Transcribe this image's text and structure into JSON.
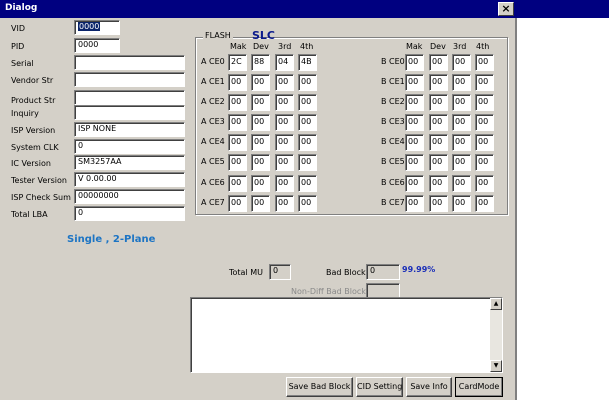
{
  "window": {
    "title": "Dialog",
    "close_glyph": "×"
  },
  "device": {
    "fields": [
      {
        "label": "VID",
        "value": "0000"
      },
      {
        "label": "PID",
        "value": "0000"
      },
      {
        "label": "Serial",
        "value": ""
      },
      {
        "label": "Vendor Str",
        "value": ""
      },
      {
        "label": "Product Str",
        "value": ""
      },
      {
        "label": "Inquiry",
        "value": ""
      },
      {
        "label": "ISP Version",
        "value": "ISP NONE"
      },
      {
        "label": "System CLK",
        "value": "0"
      },
      {
        "label": "IC Version",
        "value": "SM3257AA"
      },
      {
        "label": "Tester Version",
        "value": "V 0.00.00"
      },
      {
        "label": "ISP Check Sum",
        "value": "00000000"
      },
      {
        "label": "Total LBA",
        "value": "0"
      }
    ]
  },
  "flash": {
    "group_title": "FLASH",
    "cell_type": "SLC",
    "columns": [
      "Mak",
      "Dev",
      "3rd",
      "4th"
    ],
    "a_rows": [
      {
        "label": "A CE0",
        "values": [
          "2C",
          "88",
          "04",
          "4B"
        ]
      },
      {
        "label": "A CE1",
        "values": [
          "00",
          "00",
          "00",
          "00"
        ]
      },
      {
        "label": "A CE2",
        "values": [
          "00",
          "00",
          "00",
          "00"
        ]
      },
      {
        "label": "A CE3",
        "values": [
          "00",
          "00",
          "00",
          "00"
        ]
      },
      {
        "label": "A CE4",
        "values": [
          "00",
          "00",
          "00",
          "00"
        ]
      },
      {
        "label": "A CE5",
        "values": [
          "00",
          "00",
          "00",
          "00"
        ]
      },
      {
        "label": "A CE6",
        "values": [
          "00",
          "00",
          "00",
          "00"
        ]
      },
      {
        "label": "A CE7",
        "values": [
          "00",
          "00",
          "00",
          "00"
        ]
      }
    ],
    "b_rows": [
      {
        "label": "B CE0",
        "values": [
          "00",
          "00",
          "00",
          "00"
        ]
      },
      {
        "label": "B CE1",
        "values": [
          "00",
          "00",
          "00",
          "00"
        ]
      },
      {
        "label": "B CE2",
        "values": [
          "00",
          "00",
          "00",
          "00"
        ]
      },
      {
        "label": "B CE3",
        "values": [
          "00",
          "00",
          "00",
          "00"
        ]
      },
      {
        "label": "B CE4",
        "values": [
          "00",
          "00",
          "00",
          "00"
        ]
      },
      {
        "label": "B CE5",
        "values": [
          "00",
          "00",
          "00",
          "00"
        ]
      },
      {
        "label": "B CE6",
        "values": [
          "00",
          "00",
          "00",
          "00"
        ]
      },
      {
        "label": "B CE7",
        "values": [
          "00",
          "00",
          "00",
          "00"
        ]
      }
    ]
  },
  "plane_mode": "Single , 2-Plane",
  "stats": {
    "total_mu_label": "Total MU",
    "total_mu_value": "0",
    "bad_block_label": "Bad Block",
    "bad_block_value": "0",
    "bad_block_percent": "99.99%",
    "non_diff_label": "Non-Diff Bad Block",
    "non_diff_value": ""
  },
  "log": {
    "text": "",
    "scroll_up": "▲",
    "scroll_down": "▼"
  },
  "buttons": {
    "save_bad_block": "Save Bad Block",
    "cid_setting": "CID Setting",
    "save_info": "Save Info",
    "card_mode": "CardMode"
  },
  "colors": {
    "title_bar": "#000080",
    "dialog_bg": "#d4d0c8",
    "accent_slc": "#0a1a8c",
    "accent_plane": "#1c74c4",
    "accent_percent": "#1a2eb8"
  }
}
